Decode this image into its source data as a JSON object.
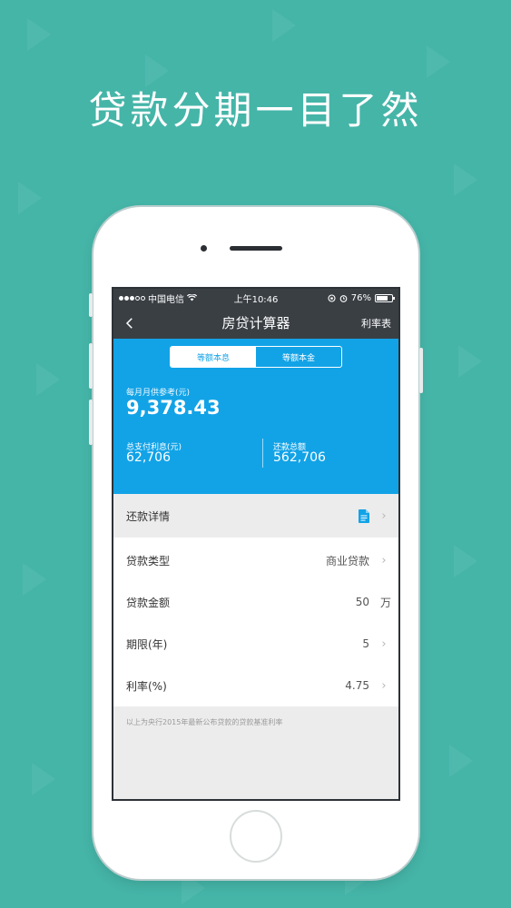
{
  "headline": "贷款分期一目了然",
  "status_bar": {
    "carrier": "中国电信",
    "time": "上午10:46",
    "battery": "76%",
    "battery_level": 0.76
  },
  "nav": {
    "back_icon": "chevron-left-icon",
    "title": "房贷计算器",
    "right_label": "利率表"
  },
  "tabs": [
    {
      "label": "等额本息",
      "active": true
    },
    {
      "label": "等额本金",
      "active": false
    }
  ],
  "summary": {
    "monthly_label": "每月月供参考(元)",
    "monthly_value": "9,378.43",
    "interest_label": "总支付利息(元)",
    "interest_value": "62,706",
    "total_label": "还款总额",
    "total_value": "562,706"
  },
  "detail": {
    "label": "还款详情",
    "icon": "document-icon",
    "accent": "#12a3e7"
  },
  "rows": [
    {
      "label": "贷款类型",
      "value": "商业贷款"
    },
    {
      "label": "贷款金额",
      "value": "50",
      "unit": "万"
    },
    {
      "label": "期限(年)",
      "value": "5"
    },
    {
      "label": "利率(%)",
      "value": "4.75"
    }
  ],
  "footnote": "以上为央行2015年最新公布贷款的贷款基准利率",
  "colors": {
    "background": "#45b5a8",
    "panel": "#12a3e7",
    "navbar": "#3a3f44"
  }
}
